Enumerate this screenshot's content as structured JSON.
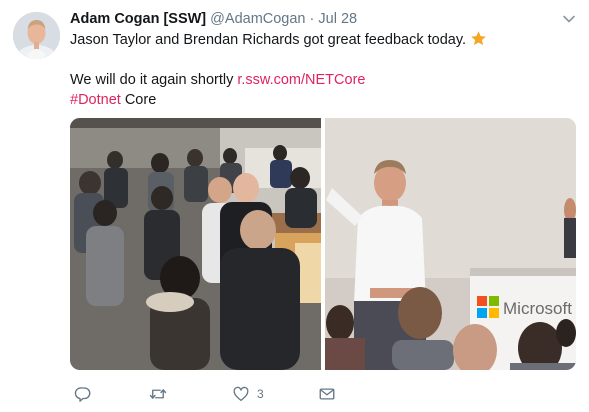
{
  "tweet": {
    "author_name": "Adam Cogan [SSW]",
    "handle": "@AdamCogan",
    "separator": "·",
    "date": "Jul 28",
    "text_line1": "Jason Taylor and Brendan Richards got great feedback today.",
    "text_line2_prefix": "We will do it again shortly ",
    "link_text": "r.ssw.com/NETCore",
    "hashtag": "#Dotnet",
    "line3_suffix": " Core",
    "photo_logo_text": "Microsoft"
  },
  "actions": {
    "like_count": "3"
  },
  "colors": {
    "link": "#e0245e",
    "secondary_text": "#657786",
    "icon": "#657786",
    "star": "#f5a623"
  },
  "icons": {
    "more": "chevron-down-icon",
    "reply": "reply-icon",
    "retweet": "retweet-icon",
    "like": "heart-icon",
    "message": "envelope-icon",
    "emoji": "star-emoji-icon"
  }
}
